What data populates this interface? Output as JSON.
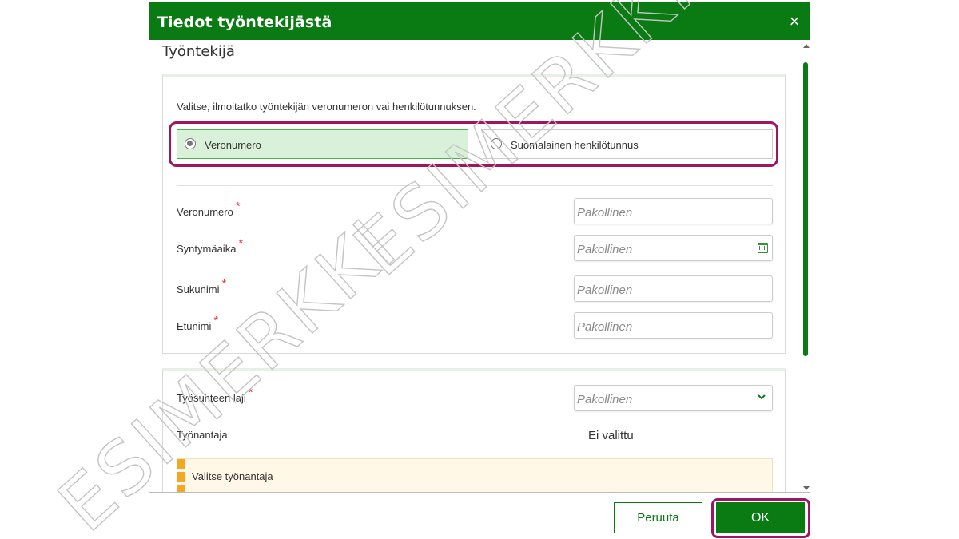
{
  "dialog": {
    "title": "Tiedot työntekijästä",
    "close_glyph": "×"
  },
  "section": {
    "title": "Työntekijä"
  },
  "identity": {
    "instruction": "Valitse, ilmoitatko työntekijän veronumeron vai henkilötunnuksen.",
    "options": [
      {
        "label": "Veronumero",
        "selected": true
      },
      {
        "label": "Suomalainen henkilötunnus",
        "selected": false
      }
    ]
  },
  "fields": [
    {
      "label": "Veronumero",
      "required": "*",
      "placeholder": "Pakollinen"
    },
    {
      "label": "Syntymäaika",
      "required": "*",
      "placeholder": "Pakollinen",
      "icon": "calendar-icon"
    },
    {
      "label": "Sukunimi",
      "required": "*",
      "placeholder": "Pakollinen"
    },
    {
      "label": "Etunimi",
      "required": "*",
      "placeholder": "Pakollinen"
    }
  ],
  "employment": {
    "type_label": "Työsuhteen laji",
    "type_required": "*",
    "type_placeholder": "Pakollinen",
    "employer_label": "Työnantaja",
    "employer_value": "Ei valittu",
    "notice": "Valitse työnantaja"
  },
  "buttons": {
    "cancel": "Peruuta",
    "ok": "OK"
  },
  "watermark": {
    "text": "ESIMERKKI"
  },
  "colors": {
    "primary": "#0a7a12",
    "highlight": "#a0155f",
    "selected_bg": "#d8f1d8",
    "required": "#e53935",
    "notice_bg": "#fff8e6",
    "notice_stripe": "#f5a623"
  }
}
